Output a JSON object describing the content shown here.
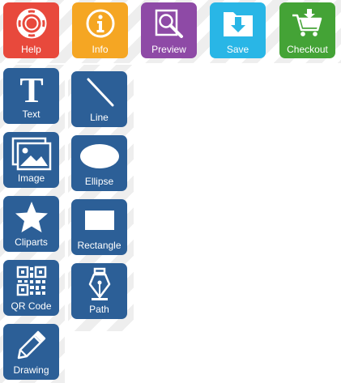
{
  "toolbar": {
    "help": {
      "label": "Help",
      "icon": "lifebuoy-icon",
      "color": "#e8493c"
    },
    "info": {
      "label": "Info",
      "icon": "info-icon",
      "color": "#f5a623"
    },
    "preview": {
      "label": "Preview",
      "icon": "magnifier-icon",
      "color": "#8e4aa6"
    },
    "save": {
      "label": "Save",
      "icon": "download-folder-icon",
      "color": "#29b6e6"
    },
    "checkout": {
      "label": "Checkout",
      "icon": "cart-icon",
      "color": "#44a336"
    }
  },
  "tools": {
    "text": {
      "label": "Text",
      "icon": "text-t-icon"
    },
    "image": {
      "label": "Image",
      "icon": "image-icon"
    },
    "cliparts": {
      "label": "Cliparts",
      "icon": "star-icon"
    },
    "qrcode": {
      "label": "QR Code",
      "icon": "qr-code-icon"
    },
    "drawing": {
      "label": "Drawing",
      "icon": "pencil-icon"
    },
    "line": {
      "label": "Line",
      "icon": "line-icon"
    },
    "ellipse": {
      "label": "Ellipse",
      "icon": "ellipse-icon"
    },
    "rectangle": {
      "label": "Rectangle",
      "icon": "rectangle-icon"
    },
    "path": {
      "label": "Path",
      "icon": "pen-nib-icon"
    }
  },
  "colors": {
    "tool_bg": "#2c5f97"
  }
}
